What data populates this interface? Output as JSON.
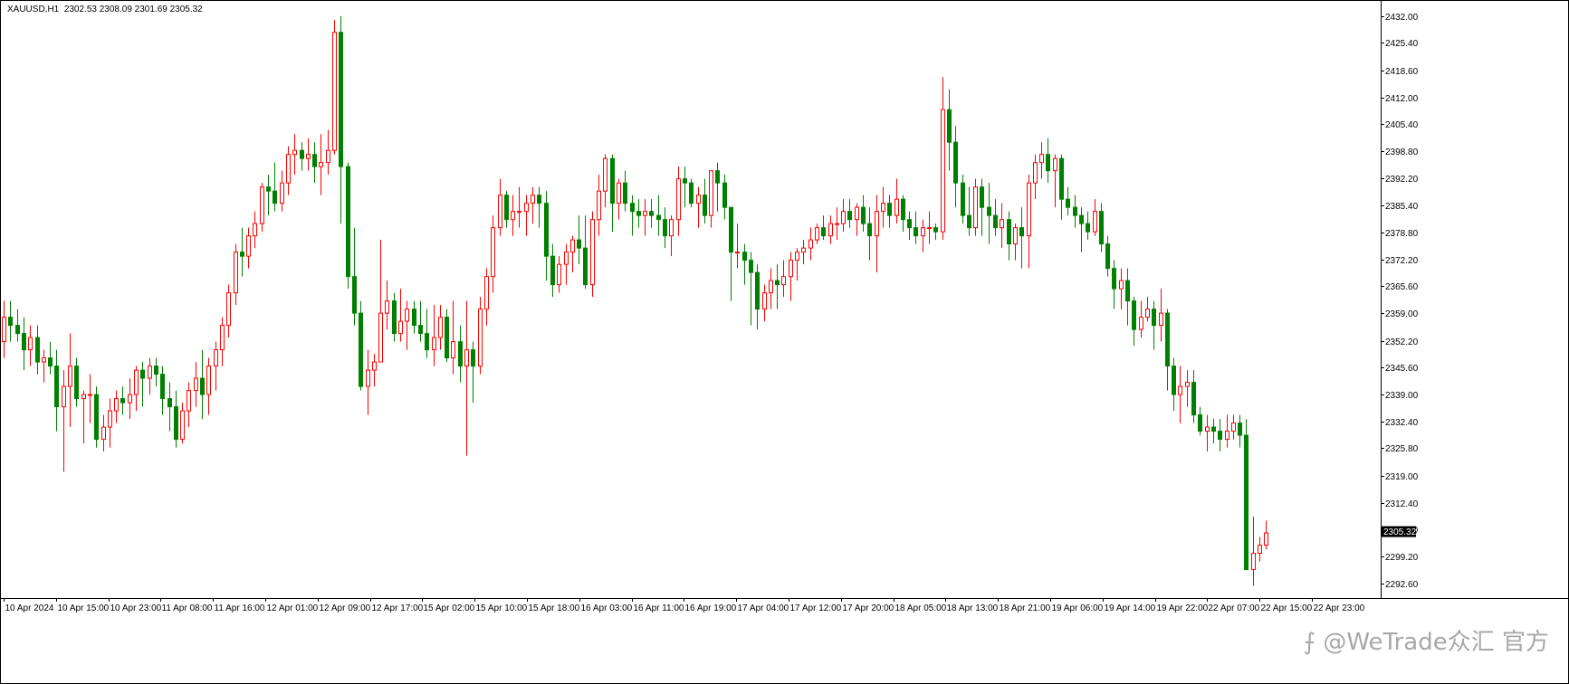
{
  "header": {
    "symbol": "XAUUSD,H1",
    "ohlc": "2302.53 2308.09 2301.69 2305.32"
  },
  "watermark": {
    "text": "⨍ @WeTrade众汇 官方"
  },
  "chart_data": {
    "type": "candlestick",
    "symbol": "XAUUSD,H1",
    "ylim": [
      2289.0,
      2435.5
    ],
    "yticks": [
      2292.6,
      2299.2,
      2305.8,
      2312.4,
      2319.0,
      2325.8,
      2332.4,
      2339.0,
      2345.6,
      2352.2,
      2359.0,
      2365.6,
      2372.2,
      2378.8,
      2385.4,
      2392.2,
      2398.8,
      2405.4,
      2412.0,
      2418.6,
      2425.4,
      2432.0
    ],
    "ytick_labels": [
      "2292.60",
      "2299.20",
      "2305.80",
      "2312.40",
      "2319.00",
      "2325.80",
      "2332.40",
      "2339.00",
      "2345.60",
      "2352.20",
      "2359.00",
      "2365.60",
      "2372.20",
      "2378.80",
      "2385.40",
      "2392.20",
      "2398.80",
      "2405.40",
      "2412.00",
      "2418.60",
      "2425.40",
      "2432.00"
    ],
    "xtick_labels": [
      "10 Apr 2024",
      "10 Apr 15:00",
      "10 Apr 23:00",
      "11 Apr 08:00",
      "11 Apr 16:00",
      "12 Apr 01:00",
      "12 Apr 09:00",
      "12 Apr 17:00",
      "15 Apr 02:00",
      "15 Apr 10:00",
      "15 Apr 18:00",
      "16 Apr 03:00",
      "16 Apr 11:00",
      "16 Apr 19:00",
      "17 Apr 04:00",
      "17 Apr 12:00",
      "17 Apr 20:00",
      "18 Apr 05:00",
      "18 Apr 13:00",
      "18 Apr 21:00",
      "19 Apr 06:00",
      "19 Apr 14:00",
      "19 Apr 22:00",
      "22 Apr 07:00",
      "22 Apr 15:00",
      "22 Apr 23:00"
    ],
    "current_price": 2305.32,
    "current_price_label": "2305.32",
    "colors": {
      "up": "#ff0000",
      "down": "#008000",
      "axis": "#000000"
    },
    "candles": [
      [
        2352,
        2362,
        2348,
        2358
      ],
      [
        2358,
        2362,
        2352,
        2356
      ],
      [
        2356,
        2360,
        2352,
        2354
      ],
      [
        2354,
        2358,
        2345,
        2350
      ],
      [
        2350,
        2356,
        2346,
        2353
      ],
      [
        2353,
        2356,
        2344,
        2347
      ],
      [
        2347,
        2350,
        2342,
        2348
      ],
      [
        2348,
        2352,
        2344,
        2346
      ],
      [
        2346,
        2350,
        2330,
        2336
      ],
      [
        2336,
        2345,
        2320,
        2341
      ],
      [
        2341,
        2354,
        2331,
        2346
      ],
      [
        2346,
        2348,
        2336,
        2338
      ],
      [
        2338,
        2340,
        2327,
        2339
      ],
      [
        2339,
        2344,
        2332,
        2339
      ],
      [
        2339,
        2341,
        2326,
        2328
      ],
      [
        2328,
        2334,
        2325,
        2331
      ],
      [
        2331,
        2338,
        2326,
        2335
      ],
      [
        2335,
        2340,
        2332,
        2338
      ],
      [
        2338,
        2341,
        2334,
        2337
      ],
      [
        2337,
        2343,
        2333,
        2339
      ],
      [
        2339,
        2346,
        2335,
        2345
      ],
      [
        2345,
        2347,
        2336,
        2343
      ],
      [
        2343,
        2348,
        2339,
        2346
      ],
      [
        2346,
        2348,
        2341,
        2344
      ],
      [
        2344,
        2346,
        2334,
        2338
      ],
      [
        2338,
        2342,
        2330,
        2336
      ],
      [
        2336,
        2340,
        2326,
        2328
      ],
      [
        2328,
        2337,
        2327,
        2335
      ],
      [
        2335,
        2342,
        2331,
        2340
      ],
      [
        2340,
        2347,
        2336,
        2343
      ],
      [
        2343,
        2350,
        2333,
        2339
      ],
      [
        2339,
        2348,
        2334,
        2346
      ],
      [
        2346,
        2352,
        2340,
        2350
      ],
      [
        2350,
        2358,
        2346,
        2356
      ],
      [
        2356,
        2366,
        2353,
        2364
      ],
      [
        2364,
        2376,
        2361,
        2374
      ],
      [
        2374,
        2380,
        2368,
        2373
      ],
      [
        2373,
        2380,
        2370,
        2378
      ],
      [
        2378,
        2384,
        2375,
        2381
      ],
      [
        2381,
        2391,
        2379,
        2390
      ],
      [
        2390,
        2393,
        2383,
        2389
      ],
      [
        2389,
        2396,
        2384,
        2386
      ],
      [
        2386,
        2394,
        2384,
        2391
      ],
      [
        2391,
        2400,
        2388,
        2398
      ],
      [
        2398,
        2403,
        2393,
        2399
      ],
      [
        2399,
        2401,
        2394,
        2397
      ],
      [
        2397,
        2402,
        2394,
        2398
      ],
      [
        2398,
        2401,
        2391,
        2395
      ],
      [
        2395,
        2403,
        2388,
        2396
      ],
      [
        2396,
        2404,
        2393,
        2399
      ],
      [
        2399,
        2431,
        2398,
        2428
      ],
      [
        2428,
        2432,
        2381,
        2395
      ],
      [
        2395,
        2396,
        2365,
        2368
      ],
      [
        2368,
        2380,
        2356,
        2359
      ],
      [
        2359,
        2362,
        2340,
        2341
      ],
      [
        2341,
        2350,
        2334,
        2345
      ],
      [
        2345,
        2349,
        2341,
        2347
      ],
      [
        2347,
        2377,
        2349,
        2359
      ],
      [
        2359,
        2367,
        2355,
        2362
      ],
      [
        2362,
        2364,
        2352,
        2354
      ],
      [
        2354,
        2365,
        2352,
        2357
      ],
      [
        2357,
        2362,
        2350,
        2360
      ],
      [
        2360,
        2362,
        2354,
        2356
      ],
      [
        2356,
        2362,
        2352,
        2354
      ],
      [
        2354,
        2360,
        2348,
        2350
      ],
      [
        2350,
        2361,
        2346,
        2353
      ],
      [
        2353,
        2361,
        2350,
        2358
      ],
      [
        2358,
        2360,
        2347,
        2348
      ],
      [
        2348,
        2362,
        2344,
        2352
      ],
      [
        2352,
        2356,
        2342,
        2346
      ],
      [
        2346,
        2362,
        2324,
        2350
      ],
      [
        2350,
        2352,
        2337,
        2346
      ],
      [
        2346,
        2363,
        2344,
        2360
      ],
      [
        2360,
        2370,
        2356,
        2368
      ],
      [
        2368,
        2383,
        2364,
        2380
      ],
      [
        2380,
        2392,
        2378,
        2388
      ],
      [
        2388,
        2389,
        2380,
        2382
      ],
      [
        2382,
        2388,
        2378,
        2384
      ],
      [
        2384,
        2390,
        2380,
        2384
      ],
      [
        2384,
        2388,
        2378,
        2386
      ],
      [
        2386,
        2390,
        2381,
        2388
      ],
      [
        2388,
        2390,
        2380,
        2386
      ],
      [
        2386,
        2389,
        2367,
        2373
      ],
      [
        2373,
        2376,
        2363,
        2366
      ],
      [
        2366,
        2373,
        2364,
        2371
      ],
      [
        2371,
        2376,
        2366,
        2374
      ],
      [
        2374,
        2378,
        2369,
        2377
      ],
      [
        2377,
        2383,
        2371,
        2375
      ],
      [
        2375,
        2383,
        2365,
        2366
      ],
      [
        2366,
        2384,
        2363,
        2382
      ],
      [
        2382,
        2393,
        2378,
        2389
      ],
      [
        2389,
        2398,
        2385,
        2397
      ],
      [
        2397,
        2398,
        2379,
        2386
      ],
      [
        2386,
        2392,
        2382,
        2391
      ],
      [
        2391,
        2394,
        2384,
        2386
      ],
      [
        2386,
        2388,
        2378,
        2384
      ],
      [
        2384,
        2387,
        2380,
        2383
      ],
      [
        2383,
        2387,
        2378,
        2384
      ],
      [
        2384,
        2387,
        2380,
        2383
      ],
      [
        2383,
        2388,
        2378,
        2382
      ],
      [
        2382,
        2385,
        2375,
        2378
      ],
      [
        2378,
        2383,
        2373,
        2382
      ],
      [
        2382,
        2395,
        2378,
        2392
      ],
      [
        2392,
        2395,
        2385,
        2391
      ],
      [
        2391,
        2392,
        2385,
        2386
      ],
      [
        2386,
        2390,
        2380,
        2388
      ],
      [
        2388,
        2392,
        2381,
        2383
      ],
      [
        2383,
        2393,
        2380,
        2394
      ],
      [
        2394,
        2396,
        2384,
        2391
      ],
      [
        2391,
        2393,
        2382,
        2385
      ],
      [
        2385,
        2385,
        2362,
        2374
      ],
      [
        2374,
        2381,
        2370,
        2374
      ],
      [
        2374,
        2376,
        2366,
        2372
      ],
      [
        2372,
        2374,
        2356,
        2369
      ],
      [
        2369,
        2371,
        2355,
        2360
      ],
      [
        2360,
        2366,
        2357,
        2364
      ],
      [
        2364,
        2370,
        2360,
        2367
      ],
      [
        2367,
        2371,
        2360,
        2366
      ],
      [
        2366,
        2372,
        2363,
        2368
      ],
      [
        2368,
        2374,
        2362,
        2372
      ],
      [
        2372,
        2375,
        2367,
        2374
      ],
      [
        2374,
        2377,
        2371,
        2375
      ],
      [
        2375,
        2380,
        2372,
        2377
      ],
      [
        2377,
        2381,
        2376,
        2380
      ],
      [
        2380,
        2383,
        2377,
        2378
      ],
      [
        2378,
        2383,
        2376,
        2381
      ],
      [
        2381,
        2385,
        2377,
        2381
      ],
      [
        2381,
        2387,
        2379,
        2384
      ],
      [
        2384,
        2387,
        2380,
        2382
      ],
      [
        2382,
        2386,
        2378,
        2385
      ],
      [
        2385,
        2388,
        2379,
        2381
      ],
      [
        2381,
        2385,
        2372,
        2378
      ],
      [
        2378,
        2388,
        2369,
        2384
      ],
      [
        2384,
        2390,
        2380,
        2386
      ],
      [
        2386,
        2388,
        2380,
        2383
      ],
      [
        2383,
        2392,
        2381,
        2387
      ],
      [
        2387,
        2388,
        2379,
        2382
      ],
      [
        2382,
        2384,
        2377,
        2380
      ],
      [
        2380,
        2384,
        2376,
        2378
      ],
      [
        2378,
        2382,
        2374,
        2380
      ],
      [
        2380,
        2384,
        2376,
        2380
      ],
      [
        2380,
        2381,
        2377,
        2379
      ],
      [
        2379,
        2417,
        2377,
        2409
      ],
      [
        2409,
        2414,
        2394,
        2401
      ],
      [
        2401,
        2405,
        2385,
        2391
      ],
      [
        2391,
        2393,
        2381,
        2383
      ],
      [
        2383,
        2390,
        2378,
        2380
      ],
      [
        2380,
        2392,
        2378,
        2390
      ],
      [
        2390,
        2392,
        2378,
        2385
      ],
      [
        2385,
        2391,
        2376,
        2383
      ],
      [
        2383,
        2387,
        2378,
        2380
      ],
      [
        2380,
        2386,
        2375,
        2382
      ],
      [
        2382,
        2384,
        2372,
        2376
      ],
      [
        2376,
        2381,
        2372,
        2380
      ],
      [
        2380,
        2385,
        2370,
        2378
      ],
      [
        2378,
        2393,
        2370,
        2391
      ],
      [
        2391,
        2398,
        2387,
        2396
      ],
      [
        2396,
        2401,
        2392,
        2398
      ],
      [
        2398,
        2402,
        2391,
        2394
      ],
      [
        2394,
        2398,
        2385,
        2397
      ],
      [
        2397,
        2398,
        2382,
        2387
      ],
      [
        2387,
        2390,
        2383,
        2385
      ],
      [
        2385,
        2388,
        2380,
        2383
      ],
      [
        2383,
        2385,
        2374,
        2381
      ],
      [
        2381,
        2384,
        2377,
        2379
      ],
      [
        2379,
        2387,
        2378,
        2384
      ],
      [
        2384,
        2386,
        2374,
        2376
      ],
      [
        2376,
        2378,
        2368,
        2370
      ],
      [
        2370,
        2372,
        2360,
        2365
      ],
      [
        2365,
        2370,
        2360,
        2367
      ],
      [
        2367,
        2370,
        2356,
        2362
      ],
      [
        2362,
        2363,
        2351,
        2355
      ],
      [
        2355,
        2362,
        2353,
        2358
      ],
      [
        2358,
        2363,
        2357,
        2360
      ],
      [
        2360,
        2362,
        2350,
        2356
      ],
      [
        2356,
        2365,
        2352,
        2359
      ],
      [
        2359,
        2360,
        2340,
        2346
      ],
      [
        2346,
        2348,
        2335,
        2339
      ],
      [
        2339,
        2346,
        2332,
        2341
      ],
      [
        2341,
        2345,
        2336,
        2342
      ],
      [
        2342,
        2345,
        2332,
        2334
      ],
      [
        2334,
        2336,
        2329,
        2330
      ],
      [
        2330,
        2334,
        2325,
        2331
      ],
      [
        2331,
        2333,
        2327,
        2330
      ],
      [
        2330,
        2333,
        2325,
        2328
      ],
      [
        2328,
        2334,
        2326,
        2330
      ],
      [
        2330,
        2334,
        2328,
        2332
      ],
      [
        2332,
        2334,
        2326,
        2329
      ],
      [
        2329,
        2333,
        2296,
        2296
      ],
      [
        2296,
        2309,
        2292,
        2300
      ],
      [
        2300,
        2304,
        2298,
        2302
      ],
      [
        2302,
        2308,
        2301,
        2305
      ]
    ]
  }
}
